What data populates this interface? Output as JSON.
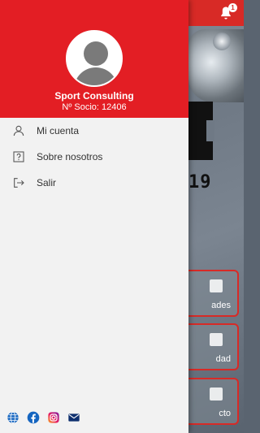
{
  "user": {
    "name": "Sport Consulting",
    "member_label": "Nº Socio: 12406"
  },
  "menu": [
    {
      "label": "Mi cuenta",
      "icon": "user-icon"
    },
    {
      "label": "Sobre nosotros",
      "icon": "question-icon"
    },
    {
      "label": "Salir",
      "icon": "logout-icon"
    }
  ],
  "social": [
    {
      "icon": "web-globe-icon"
    },
    {
      "icon": "facebook-icon"
    },
    {
      "icon": "instagram-icon"
    },
    {
      "icon": "email-icon"
    }
  ],
  "background": {
    "notification_count": "1",
    "year_text": "19",
    "cards": [
      "ades",
      "dad",
      "cto"
    ]
  },
  "colors": {
    "header_red": "#e31e24",
    "drawer_bg": "#f2f2f2",
    "accent_blue": "#1565c0"
  }
}
